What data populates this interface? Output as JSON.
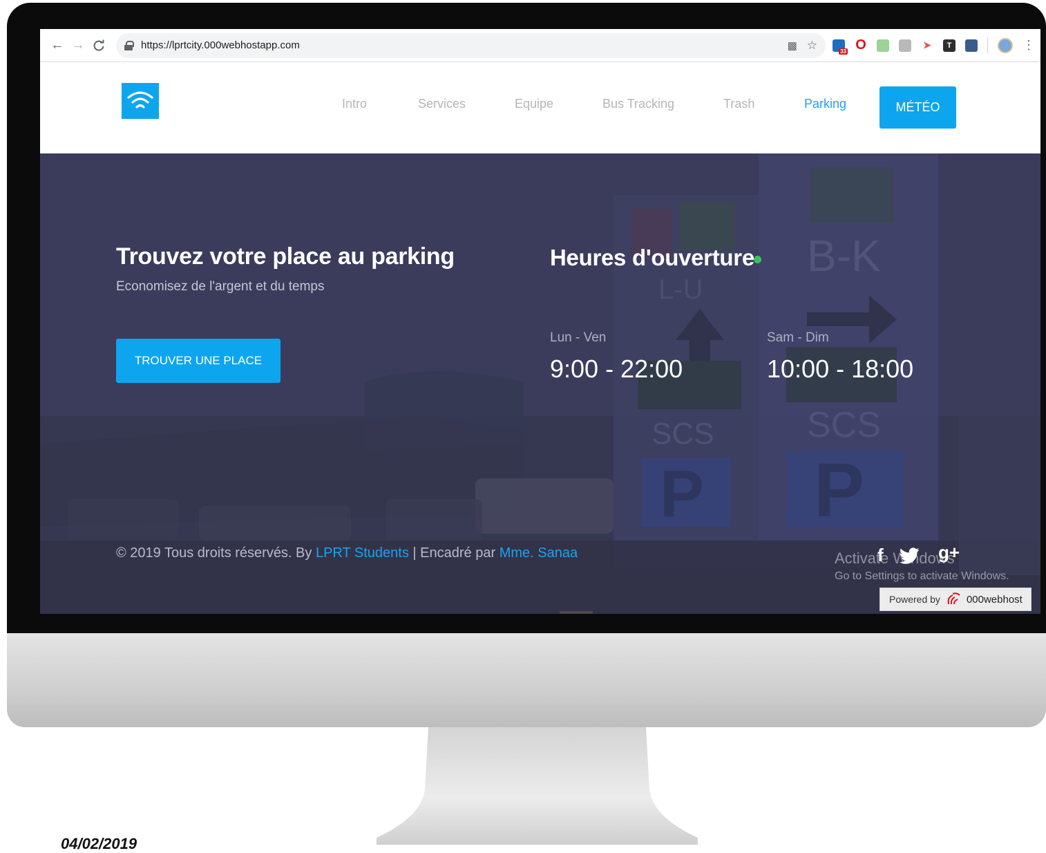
{
  "browser": {
    "url": "https://lprtcity.000webhostapp.com",
    "back_icon": "arrow-left-icon",
    "forward_icon": "arrow-right-icon",
    "reload_icon": "reload-icon",
    "ext_badge": "33"
  },
  "nav": {
    "items": [
      {
        "label": "Intro"
      },
      {
        "label": "Services"
      },
      {
        "label": "Equipe"
      },
      {
        "label": "Bus Tracking"
      },
      {
        "label": "Trash"
      },
      {
        "label": "Parking"
      }
    ],
    "active": "Parking",
    "meteo_label": "MÉTÉO"
  },
  "hero": {
    "title": "Trouvez votre place au parking",
    "subtitle": "Economisez de l'argent et du temps",
    "cta_label": "TROUVER UNE PLACE"
  },
  "hours": {
    "title": "Heures d'ouverture",
    "weekday_label": "Lun - Ven",
    "weekday_time": "9:00 - 22:00",
    "weekend_label": "Sam - Dim",
    "weekend_time": "10:00 - 18:00"
  },
  "footer": {
    "copyright": "© 2019 Tous droits réservés. By ",
    "author_link": "LPRT Students",
    "separator": " | Encadré par ",
    "supervisor_link": "Mme. Sanaa"
  },
  "social": {
    "facebook": "f",
    "google_plus": "g+"
  },
  "windows_watermark": {
    "line1": "Activate Windows",
    "line2": "Go to Settings to activate Windows."
  },
  "powered": {
    "prefix": "Powered by",
    "brand": "000webhost"
  },
  "date_stamp": "04/02/2019",
  "colors": {
    "accent": "#0ea5ef",
    "hero_bg": "#3a3b5a",
    "status": "#37c25a"
  }
}
